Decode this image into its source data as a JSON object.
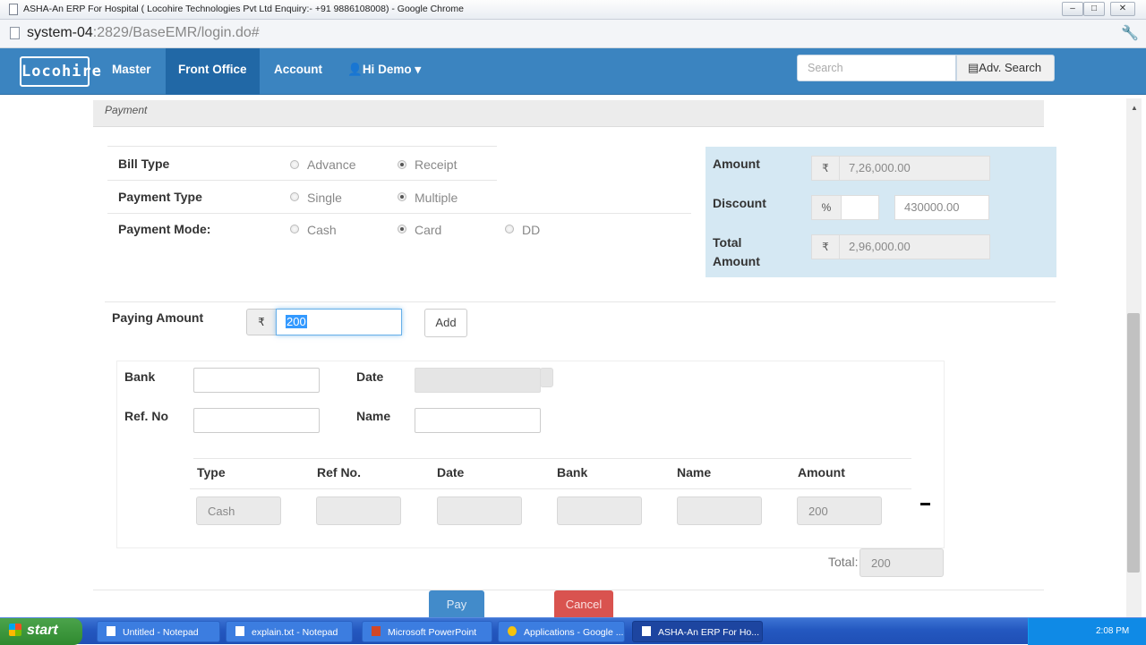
{
  "window": {
    "title": "ASHA-An ERP For Hospital ( Locohire Technologies Pvt Ltd Enquiry:- +91 9886108008) - Google Chrome",
    "minimize": "–",
    "maximize": "□",
    "close": "✕"
  },
  "address_bar": {
    "host": "system-04",
    "path": ":2829/BaseEMR/login.do#"
  },
  "navbar": {
    "logo": "Locohire",
    "items": [
      "Master",
      "Front Office",
      "Account"
    ],
    "active_item": "Front Office",
    "user_menu": "Hi Demo",
    "user_icon": "👤",
    "caret": "▾",
    "search_placeholder": "Search",
    "adv_search_icon": "▤",
    "adv_search_label": "Adv. Search"
  },
  "section": {
    "title": "Payment"
  },
  "bill_type": {
    "label": "Bill Type",
    "options": [
      "Advance",
      "Receipt"
    ],
    "selected": "Receipt"
  },
  "payment_type": {
    "label": "Payment Type",
    "options": [
      "Single",
      "Multiple"
    ],
    "selected": "Multiple"
  },
  "payment_mode": {
    "label": "Payment Mode:",
    "options": [
      "Cash",
      "Card",
      "DD"
    ],
    "selected": "Card"
  },
  "summary": {
    "amount_label": "Amount",
    "amount_currency": "₹",
    "amount_value": "7,26,000.00",
    "discount_label": "Discount",
    "discount_symbol": "%",
    "discount_percent": "",
    "discount_value": "430000.00",
    "total_label_line1": "Total",
    "total_label_line2": "Amount",
    "total_currency": "₹",
    "total_value": "2,96,000.00"
  },
  "paying": {
    "label": "Paying Amount",
    "currency": "₹",
    "value": "200",
    "add_label": "Add"
  },
  "bank_details": {
    "bank_label": "Bank",
    "bank_value": "",
    "date_label": "Date",
    "date_value": "",
    "ref_label": "Ref. No",
    "ref_value": "",
    "name_label": "Name",
    "name_value": ""
  },
  "table": {
    "headers": [
      "Type",
      "Ref No.",
      "Date",
      "Bank",
      "Name",
      "Amount"
    ],
    "rows": [
      {
        "type": "Cash",
        "ref_no": "",
        "date": "",
        "bank": "",
        "name": "",
        "amount": "200"
      }
    ],
    "total_label": "Total:",
    "total_value": "200"
  },
  "actions": {
    "pay_label": "Pay",
    "cancel_label": "Cancel"
  },
  "taskbar": {
    "start_label": "start",
    "tasks": [
      "Untitled - Notepad",
      "explain.txt - Notepad",
      "Microsoft PowerPoint",
      "Applications - Google ...",
      "ASHA-An ERP For Ho..."
    ],
    "active_task": "ASHA-An ERP For Ho...",
    "clock": "2:08 PM"
  }
}
